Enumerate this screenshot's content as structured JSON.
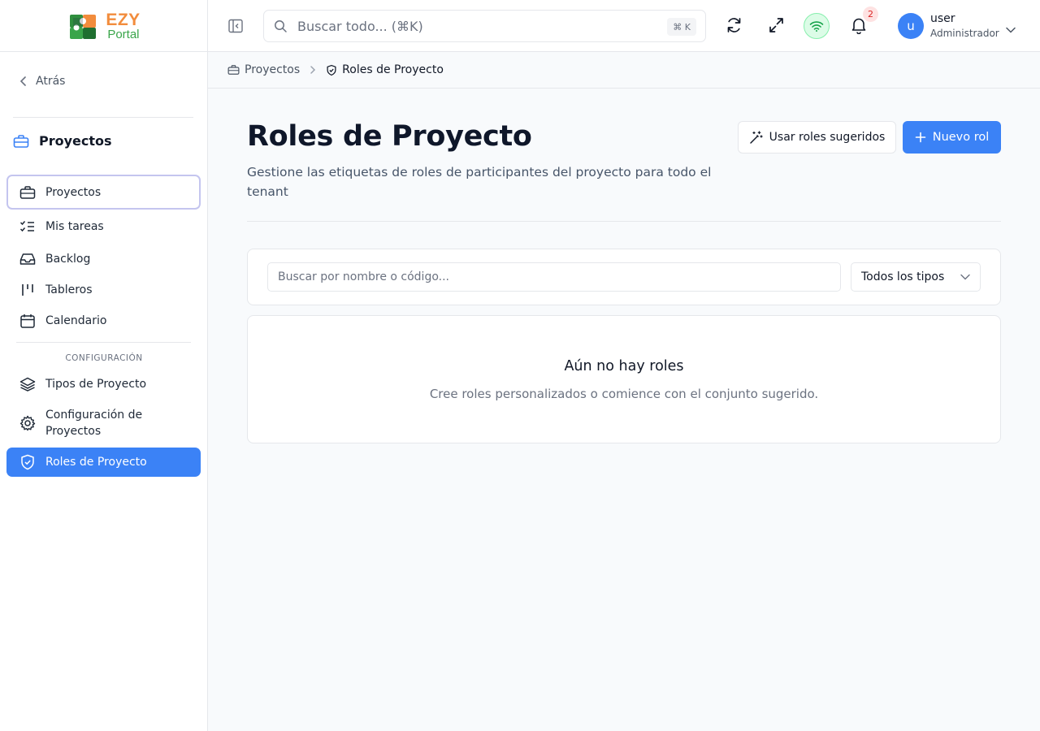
{
  "app": {
    "logo_line1": "EZY",
    "logo_line2": "Portal"
  },
  "sidebar": {
    "back_label": "Atrás",
    "section_title": "Proyectos",
    "items": [
      {
        "label": "Proyectos",
        "icon": "briefcase-icon"
      },
      {
        "label": "Mis tareas",
        "icon": "list-checks-icon"
      },
      {
        "label": "Backlog",
        "icon": "inbox-icon"
      },
      {
        "label": "Tableros",
        "icon": "kanban-icon"
      },
      {
        "label": "Calendario",
        "icon": "calendar-icon"
      }
    ],
    "config_label": "CONFIGURACIÓN",
    "config_items": [
      {
        "label": "Tipos de Proyecto",
        "icon": "layers-icon"
      },
      {
        "label": "Configuración de",
        "label2": "Proyectos",
        "icon": "gear-icon"
      },
      {
        "label": "Roles de Proyecto",
        "icon": "shield-check-icon",
        "active": true
      }
    ]
  },
  "header": {
    "search_placeholder": "Buscar todo... (⌘K)",
    "search_shortcut": "⌘ K",
    "notification_count": "2",
    "user_initial": "u",
    "user_name": "user",
    "user_role": "Administrador"
  },
  "breadcrumb": {
    "parent": "Proyectos",
    "current": "Roles de Proyecto"
  },
  "main": {
    "title": "Roles de Proyecto",
    "description": "Gestione las etiquetas de roles de participantes del proyecto para todo el tenant",
    "suggested_button": "Usar roles sugeridos",
    "new_button": "Nuevo rol",
    "filter_placeholder": "Buscar por nombre o código...",
    "type_select": "Todos los tipos",
    "empty_title": "Aún no hay roles",
    "empty_desc": "Cree roles personalizados o comience con el conjunto sugerido."
  },
  "colors": {
    "primary": "#3b82f6",
    "logo_orange": "#f28c3c",
    "logo_green": "#3aa54a",
    "wifi_green": "#22c55e"
  }
}
